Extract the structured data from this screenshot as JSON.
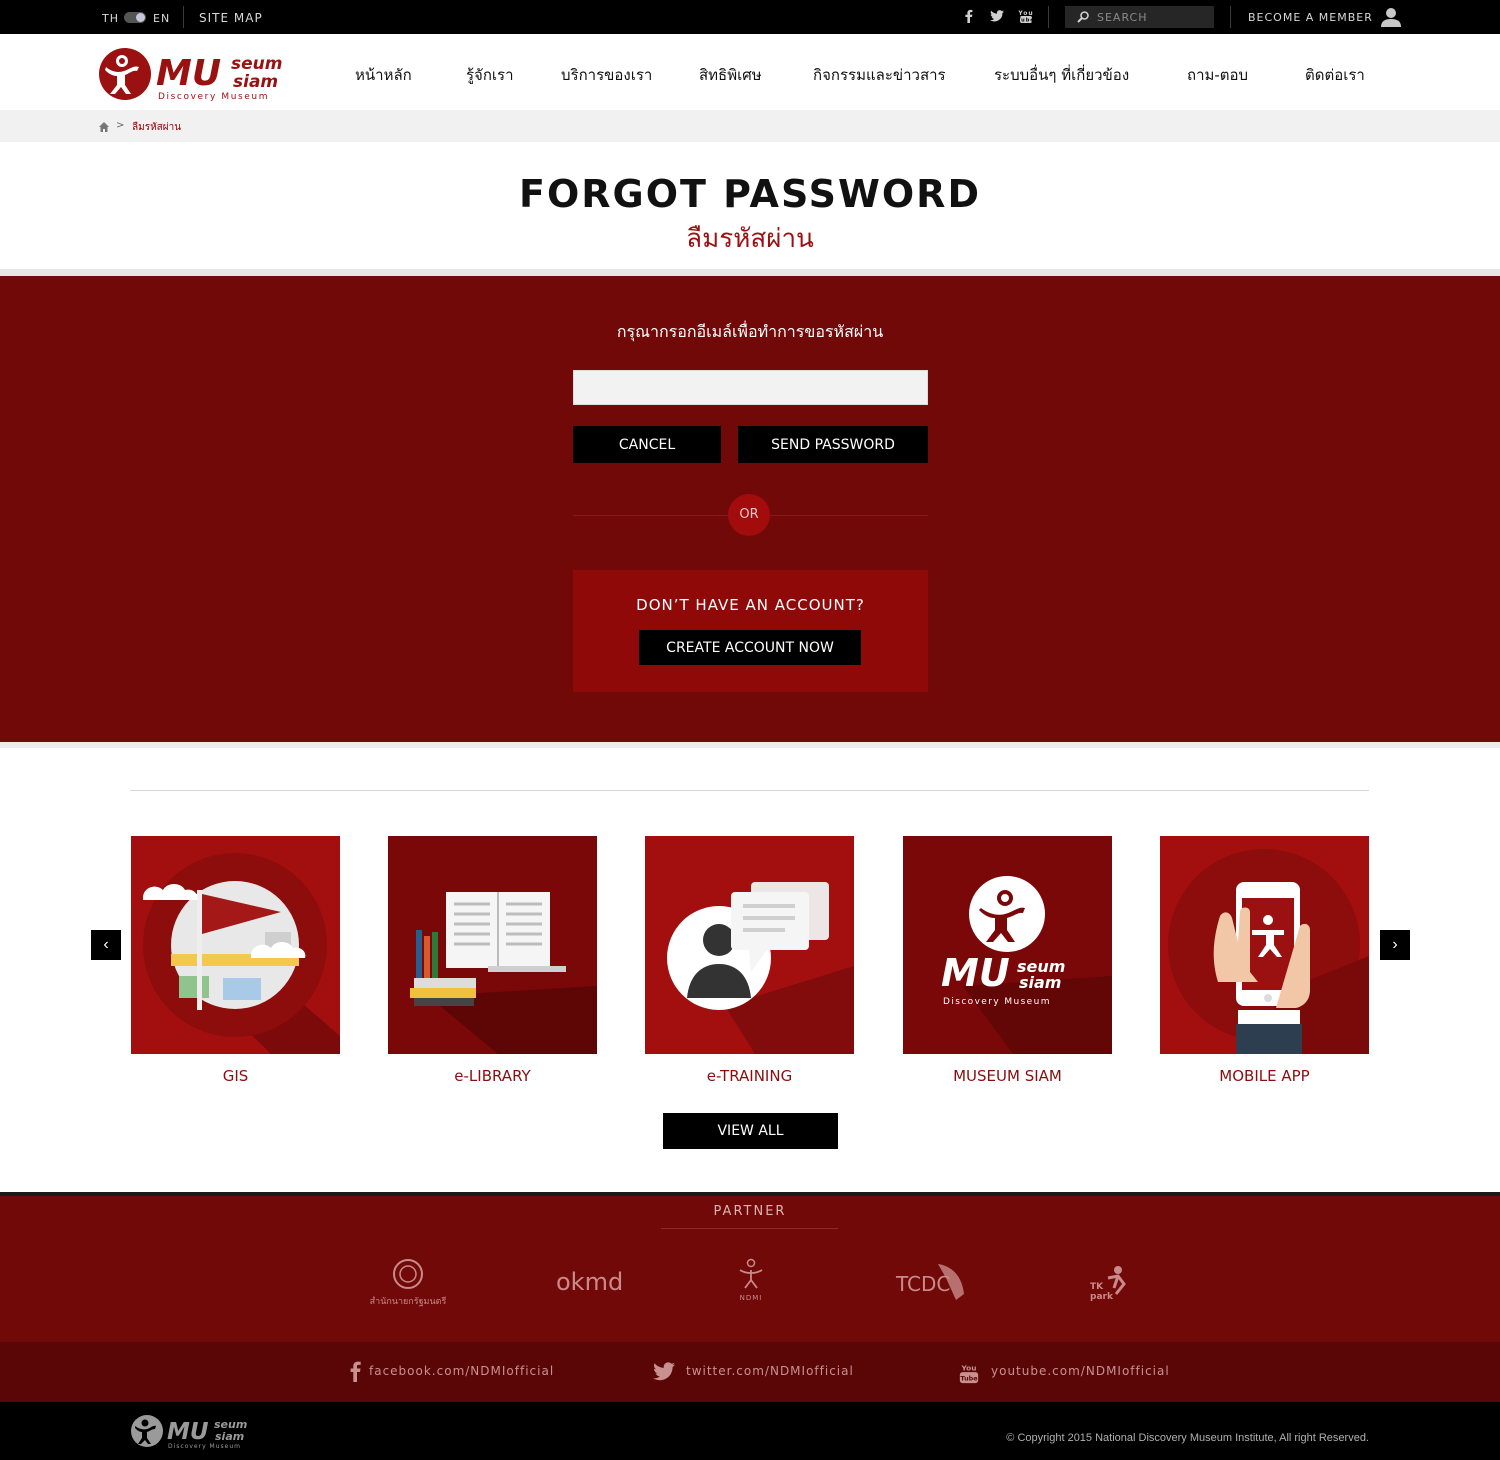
{
  "topbar": {
    "lang_th": "TH",
    "lang_en": "EN",
    "site_map": "SITE MAP",
    "social_icons": [
      "facebook-icon",
      "twitter-icon",
      "youtube-icon"
    ],
    "search_placeholder": "SEARCH",
    "become_member": "BECOME A MEMBER"
  },
  "header": {
    "logo_text": "MUseum Siam",
    "logo_tagline": "Discovery Museum",
    "nav": [
      "หน้าหลัก",
      "รู้จักเรา",
      "บริการของเรา",
      "สิทธิพิเศษ",
      "กิจกรรมและข่าวสาร",
      "ระบบอื่นๆ ที่เกี่ยวข้อง",
      "ถาม-ตอบ",
      "ติดต่อเรา"
    ]
  },
  "breadcrumb": {
    "separator": ">",
    "current": "ลืมรหัสผ่าน"
  },
  "page": {
    "title": "FORGOT PASSWORD",
    "subtitle": "ลืมรหัสผ่าน"
  },
  "form": {
    "label": "กรุณากรอกอีเมล์เพื่อทำการขอรหัสผ่าน",
    "email_value": "",
    "cancel": "CANCEL",
    "send": "SEND PASSWORD",
    "or": "OR",
    "no_account": "DON’T HAVE AN ACCOUNT?",
    "create": "CREATE ACCOUNT NOW"
  },
  "systems": {
    "items": [
      {
        "label": "GIS",
        "icon": "map-flag-icon"
      },
      {
        "label": "e-LIBRARY",
        "icon": "books-icon"
      },
      {
        "label": "e-TRAINING",
        "icon": "chat-person-icon"
      },
      {
        "label": "MUSEUM SIAM",
        "icon": "museum-siam-logo"
      },
      {
        "label": "MOBILE APP",
        "icon": "phone-hand-icon"
      }
    ],
    "view_all": "VIEW ALL"
  },
  "partner": {
    "title": "PARTNER",
    "logos": [
      {
        "name": "office-of-prime-minister-logo",
        "text": "สำนักนายกรัฐมนตรี"
      },
      {
        "name": "okmd-logo",
        "text": "okmd"
      },
      {
        "name": "ndmi-logo",
        "text": "NDMI"
      },
      {
        "name": "tcdc-logo",
        "text": "TCDC"
      },
      {
        "name": "tk-park-logo",
        "text": "TK park"
      }
    ]
  },
  "social_footer": {
    "facebook": "facebook.com/NDMIofficial",
    "twitter": "twitter.com/NDMIofficial",
    "youtube": "youtube.com/NDMIofficial"
  },
  "footer": {
    "copyright": "Copyright 2015 National Discovery Museum Institute, All right Reserved."
  },
  "colors": {
    "brand_red": "#9b1010",
    "dark_red": "#720909",
    "box_red": "#8f0909",
    "black": "#000000"
  }
}
